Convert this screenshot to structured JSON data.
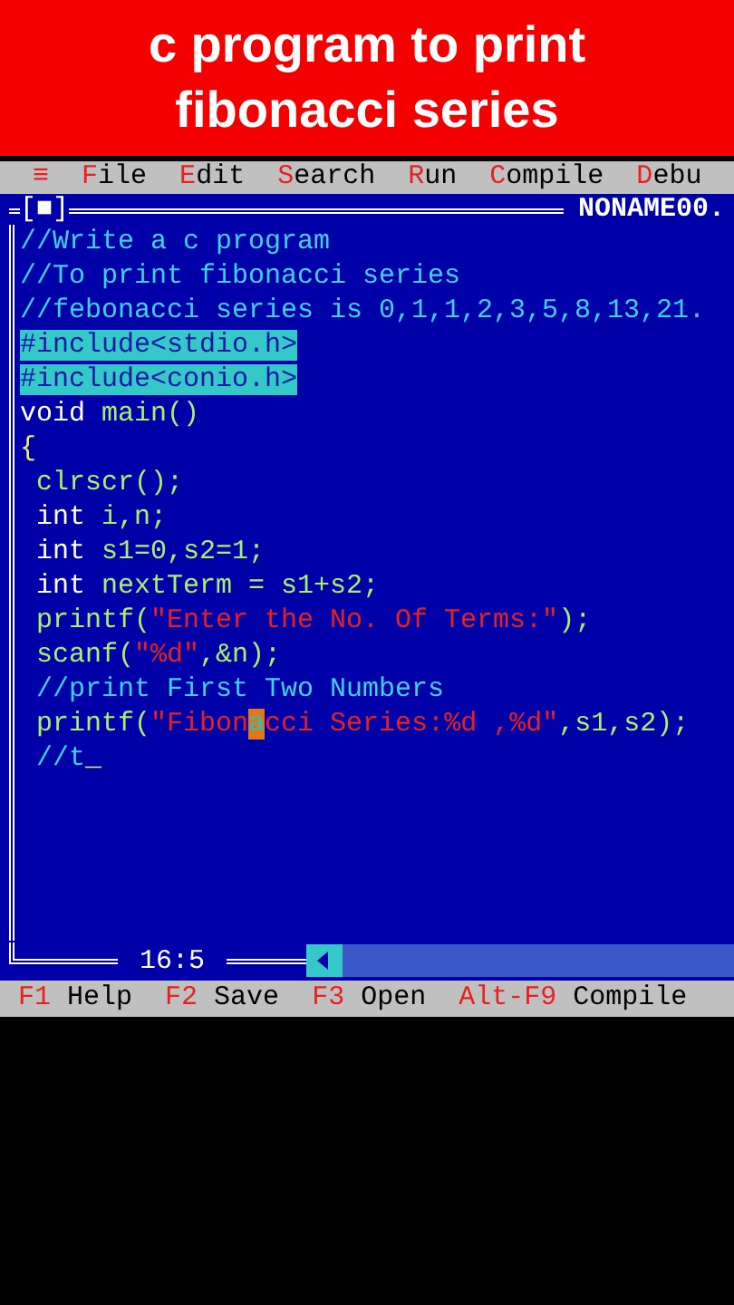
{
  "banner": {
    "lines": [
      "c program to print",
      "fibonacci series"
    ]
  },
  "menu": [
    {
      "kind": "icon",
      "text": "≡"
    },
    {
      "kind": "item",
      "hotkey": "F",
      "rest": "ile"
    },
    {
      "kind": "item",
      "hotkey": "E",
      "rest": "dit"
    },
    {
      "kind": "item",
      "hotkey": "S",
      "rest": "earch"
    },
    {
      "kind": "item",
      "hotkey": "R",
      "rest": "un"
    },
    {
      "kind": "item",
      "hotkey": "C",
      "rest": "ompile"
    },
    {
      "kind": "item",
      "hotkey": "D",
      "rest": "ebu"
    }
  ],
  "editor": {
    "close_box": "[■]",
    "filename": "NONAME00.",
    "lines": [
      [
        {
          "kind": "comment",
          "text": "//Write a c program"
        }
      ],
      [
        {
          "kind": "comment",
          "text": "//To print fibonacci series"
        }
      ],
      [
        {
          "kind": "comment",
          "text": "//febonacci series is 0,1,1,2,3,5,8,13,21."
        }
      ],
      [
        {
          "kind": "preproc",
          "text": "#include<stdio.h>"
        }
      ],
      [
        {
          "kind": "preproc",
          "text": "#include<conio.h>"
        }
      ],
      [
        {
          "kind": "keyword",
          "text": "void"
        },
        {
          "kind": "ident",
          "text": " main()"
        }
      ],
      [
        {
          "kind": "symbol",
          "text": "{"
        }
      ],
      [
        {
          "kind": "ident",
          "text": " clrscr();"
        }
      ],
      [
        {
          "kind": "keyword",
          "text": " int"
        },
        {
          "kind": "ident",
          "text": " i,n;"
        }
      ],
      [
        {
          "kind": "keyword",
          "text": " int"
        },
        {
          "kind": "ident",
          "text": " s1=0,s2=1;"
        }
      ],
      [
        {
          "kind": "keyword",
          "text": " int"
        },
        {
          "kind": "ident",
          "text": " nextTerm = s1+s2;"
        }
      ],
      [
        {
          "kind": "ident",
          "text": " printf("
        },
        {
          "kind": "string",
          "text": "\"Enter the No. Of Terms:\""
        },
        {
          "kind": "ident",
          "text": ");"
        }
      ],
      [
        {
          "kind": "ident",
          "text": " scanf("
        },
        {
          "kind": "string",
          "text": "\"%d\""
        },
        {
          "kind": "ident",
          "text": ",&n);"
        }
      ],
      [
        {
          "kind": "comment",
          "text": " //print First Two Numbers"
        }
      ],
      [
        {
          "kind": "ident",
          "text": " printf("
        },
        {
          "kind": "string",
          "text": "\"Fibon"
        },
        {
          "kind": "cursor",
          "text": "a"
        },
        {
          "kind": "string",
          "text": "cci Series:%d ,%d\""
        },
        {
          "kind": "ident",
          "text": ",s1,s2);"
        }
      ],
      [
        {
          "kind": "comment",
          "text": " //t"
        },
        {
          "kind": "caret",
          "text": "_"
        }
      ]
    ],
    "position": "16:5"
  },
  "status_bar": [
    {
      "key": "F1",
      "label": "Help"
    },
    {
      "key": "F2",
      "label": "Save"
    },
    {
      "key": "F3",
      "label": "Open"
    },
    {
      "key": "Alt-F9",
      "label": "Compile"
    }
  ]
}
